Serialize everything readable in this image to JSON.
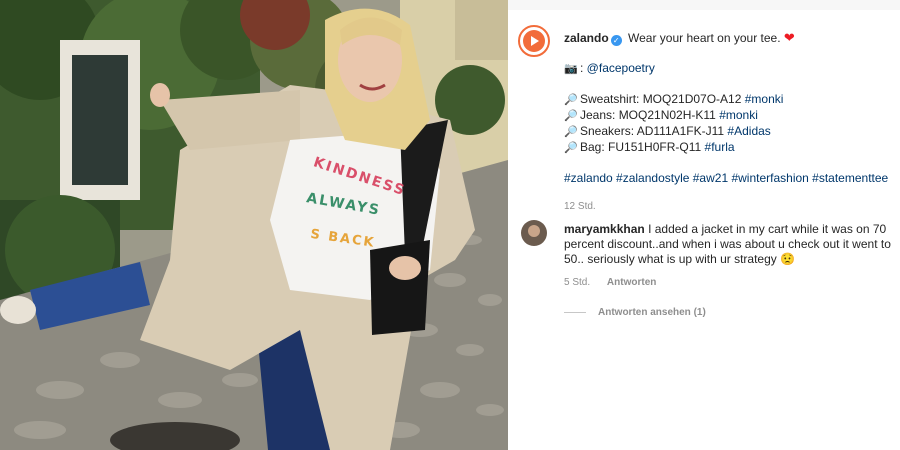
{
  "post": {
    "username": "zalando",
    "caption_main": "Wear your heart on your tee.",
    "photo_credit": "@facepoetry",
    "items": [
      {
        "label": "Sweatshirt: MOQ21D07O-A12",
        "tag": "#monki"
      },
      {
        "label": "Jeans: MOQ21N02H-K11",
        "tag": "#monki"
      },
      {
        "label": "Sneakers: AD111A1FK-J11",
        "tag": "#Adidas"
      },
      {
        "label": "Bag: FU151H0FR-Q11",
        "tag": "#furla"
      }
    ],
    "hashtags": "#zalando #zalandostyle #aw21 #winterfashion #statementtee",
    "time": "12 Std."
  },
  "comment": {
    "username": "maryamkkhan",
    "text": "I added a jacket in my cart while it was on 70 percent discount..and when i was about u check out it went to 50.. seriously what is up with ur strategy",
    "emoji": "😟",
    "time": "5 Std.",
    "reply_label": "Antworten",
    "view_replies": "Antworten ansehen (1)"
  },
  "photo": {
    "sweatshirt_text_1": "KINDNESS",
    "sweatshirt_text_2": "ALWAYS",
    "sweatshirt_text_3": "S BACK"
  },
  "icons": {
    "verified": "verified-badge-icon",
    "camera": "camera-icon",
    "search": "magnifier-icon",
    "heart": "red-heart-icon"
  },
  "colors": {
    "brand": "#f26c3a",
    "hashtag": "#00376b",
    "meta": "#8e8e8e"
  }
}
